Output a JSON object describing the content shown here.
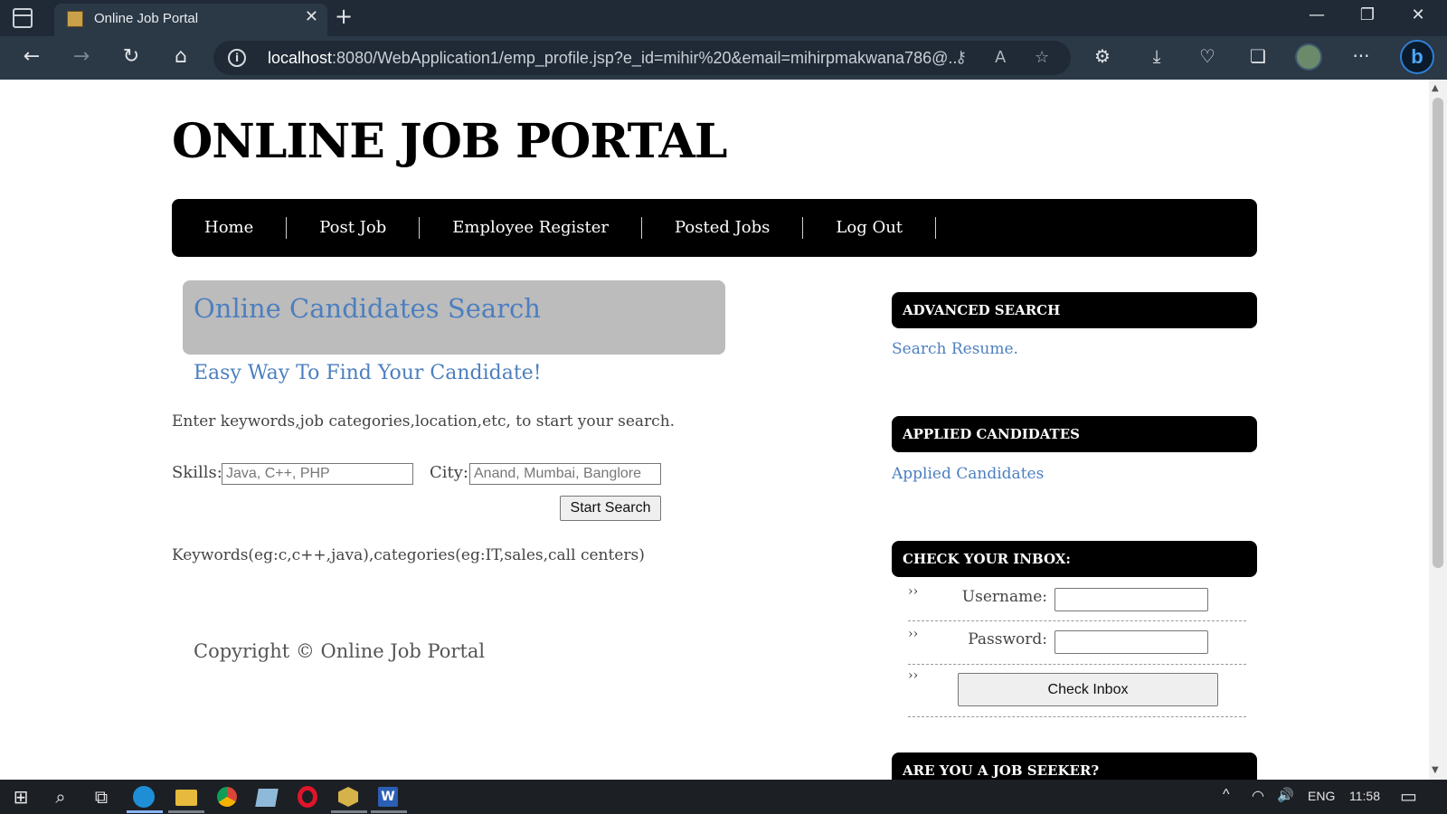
{
  "browser": {
    "tab_title": "Online Job Portal",
    "url_host": "localhost",
    "url_rest": ":8080/WebApplication1/emp_profile.jsp?e_id=mihir%20&email=mihirpmakwana786@...",
    "icons": {
      "sidebar": "tab-actions-icon",
      "close_tab": "✕",
      "new_tab": "+",
      "minimize": "—",
      "restore": "❐",
      "close_window": "✕",
      "back": "←",
      "forward": "→",
      "reload": "↻",
      "home": "⌂",
      "info": "i",
      "key": "⚷",
      "read_aloud": "A",
      "favorite": "☆",
      "extensions": "⚙",
      "downloads": "⤓",
      "browser_essentials": "♡",
      "collections": "❏",
      "more": "···",
      "copilot": "b"
    }
  },
  "site": {
    "title": "ONLINE JOB PORTAL",
    "nav": [
      "Home",
      "Post Job",
      "Employee Register",
      "Posted Jobs",
      "Log Out"
    ]
  },
  "search": {
    "heading": "Online Candidates Search",
    "subheading": "Easy Way To Find Your Candidate!",
    "description": "Enter keywords,job categories,location,etc, to start your search.",
    "skills_label": "Skills:",
    "skills_placeholder": "Java, C++, PHP",
    "city_label": "City:",
    "city_placeholder": "Anand, Mumbai, Banglore",
    "button": "Start Search",
    "keywords_hint": "Keywords(eg:c,c++,java),categories(eg:IT,sales,call centers)"
  },
  "footer": {
    "copyright": "Copyright © Online Job Portal"
  },
  "sidebar": {
    "advanced_heading": "ADVANCED SEARCH",
    "advanced_link": "Search Resume.",
    "applied_heading": "APPLIED CANDIDATES",
    "applied_link": "Applied Candidates",
    "inbox_heading": "CHECK YOUR INBOX:",
    "username_label": "Username:",
    "password_label": "Password:",
    "inbox_button": "Check Inbox",
    "bullet": "››",
    "seeker_heading": "ARE YOU A JOB SEEKER?"
  },
  "taskbar": {
    "start": "⊞",
    "search": "⌕",
    "taskview": "⧉",
    "apps": [
      "edge-icon",
      "file-explorer-icon",
      "chrome-icon",
      "app-icon",
      "opera-icon",
      "package-icon",
      "word-icon"
    ],
    "tray_chevron": "^",
    "network": "◠",
    "volume": "🔊",
    "language": "ENG",
    "time": "11:58",
    "notifications": "▭"
  }
}
